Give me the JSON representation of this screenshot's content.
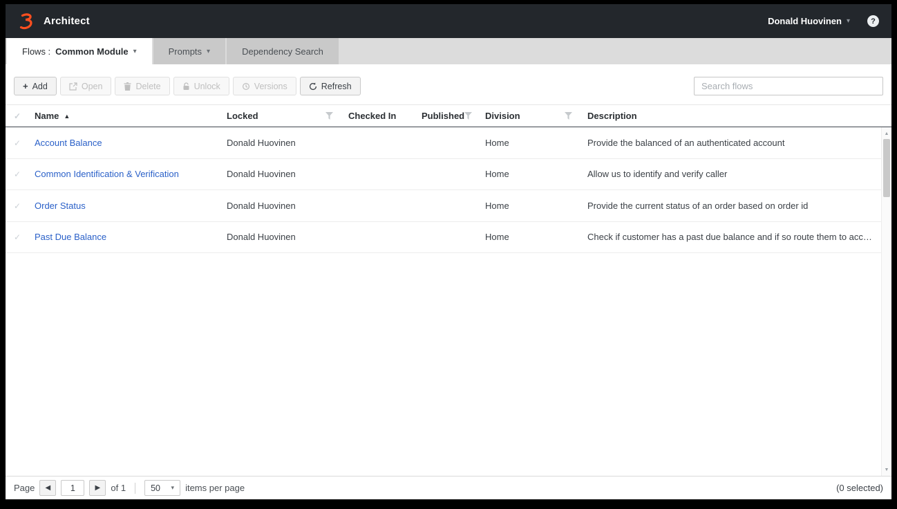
{
  "topbar": {
    "app_name": "Architect",
    "user_name": "Donald Huovinen",
    "help_glyph": "?"
  },
  "icons": {
    "caret_down": "▾",
    "sort_asc": "▲",
    "check": "✓",
    "plus": "+",
    "prev": "◀",
    "next": "▶",
    "scroll_up": "▲",
    "scroll_down": "▼"
  },
  "tabs": {
    "flows_prefix": "Flows :",
    "flows_label": "Common Module",
    "prompts_label": "Prompts",
    "dependency_label": "Dependency Search"
  },
  "toolbar": {
    "add_label": "Add",
    "open_label": "Open",
    "delete_label": "Delete",
    "unlock_label": "Unlock",
    "versions_label": "Versions",
    "refresh_label": "Refresh",
    "search_placeholder": "Search flows"
  },
  "table": {
    "headers": {
      "name": "Name",
      "locked": "Locked",
      "checked_in": "Checked In",
      "published": "Published",
      "division": "Division",
      "description": "Description"
    },
    "rows": [
      {
        "name": "Account Balance",
        "locked": "Donald Huovinen",
        "checked_in": "",
        "published": "",
        "division": "Home",
        "description": "Provide the balanced of an authenticated account"
      },
      {
        "name": "Common Identification & Verification",
        "locked": "Donald Huovinen",
        "checked_in": "",
        "published": "",
        "division": "Home",
        "description": "Allow us to identify and verify caller"
      },
      {
        "name": "Order Status",
        "locked": "Donald Huovinen",
        "checked_in": "",
        "published": "",
        "division": "Home",
        "description": "Provide the current status of an order based on order id"
      },
      {
        "name": "Past Due Balance",
        "locked": "Donald Huovinen",
        "checked_in": "",
        "published": "",
        "division": "Home",
        "description": "Check if customer has a past due balance and if so route them to acc…"
      }
    ]
  },
  "footer": {
    "page_label": "Page",
    "page_value": "1",
    "of_label": "of 1",
    "page_size": "50",
    "items_label": "items per page",
    "selected_label": "(0 selected)"
  },
  "colors": {
    "accent_orange": "#ff4f1f",
    "link_blue": "#2a60c8",
    "topbar_bg": "#23272c",
    "tabbar_bg": "#dcdcdc"
  }
}
